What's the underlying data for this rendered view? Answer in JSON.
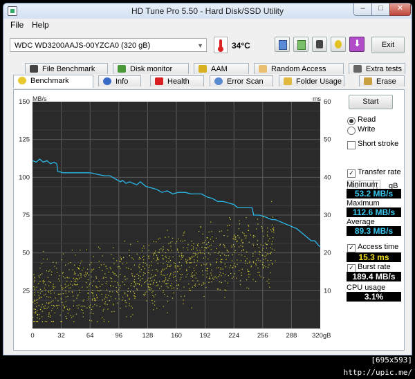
{
  "window": {
    "title": "HD Tune Pro 5.50 - Hard Disk/SSD Utility",
    "controls": {
      "minimize": "–",
      "maximize": "□",
      "close": "✕"
    }
  },
  "menu": {
    "file": "File",
    "help": "Help"
  },
  "toolbar": {
    "drive": "WDC WD3200AAJS-00YZCA0 (320 gB)",
    "temperature": "34°C",
    "exit_label": "Exit",
    "icons": [
      "copy-info-icon",
      "copy-text-icon",
      "camera-icon",
      "options-icon",
      "save-icon"
    ]
  },
  "tabs_top": [
    {
      "label": "File Benchmark",
      "icon": "file-benchmark-icon"
    },
    {
      "label": "Disk monitor",
      "icon": "disk-monitor-icon"
    },
    {
      "label": "AAM",
      "icon": "speaker-icon"
    },
    {
      "label": "Random Access",
      "icon": "random-access-icon"
    },
    {
      "label": "Extra tests",
      "icon": "extra-tests-icon"
    }
  ],
  "tabs_bottom": [
    {
      "label": "Benchmark",
      "icon": "benchmark-icon",
      "active": true
    },
    {
      "label": "Info",
      "icon": "info-icon"
    },
    {
      "label": "Health",
      "icon": "health-icon"
    },
    {
      "label": "Error Scan",
      "icon": "error-scan-icon"
    },
    {
      "label": "Folder Usage",
      "icon": "folder-icon"
    },
    {
      "label": "Erase",
      "icon": "erase-icon"
    }
  ],
  "side": {
    "start_label": "Start",
    "read_label": "Read",
    "write_label": "Write",
    "short_stroke_label": "Short stroke",
    "gb_value": "40",
    "gb_unit": "gB",
    "transfer_rate_label": "Transfer rate",
    "minimum_label": "Minimum",
    "minimum_value": "53.2 MB/s",
    "maximum_label": "Maximum",
    "maximum_value": "112.6 MB/s",
    "average_label": "Average",
    "average_value": "89.3 MB/s",
    "access_time_label": "Access time",
    "access_time_value": "15.3 ms",
    "burst_rate_label": "Burst rate",
    "burst_rate_value": "189.4 MB/s",
    "cpu_usage_label": "CPU usage",
    "cpu_usage_value": "3.1%"
  },
  "colors": {
    "transfer": "#2ab8e8",
    "access": "#d8d230",
    "value_cyan": "#38c8f0",
    "value_yellow": "#f0e020"
  },
  "chart_data": {
    "type": "line",
    "y_left_unit": "MB/s",
    "y_right_unit": "ms",
    "ylim_left": [
      0,
      150
    ],
    "ylim_right": [
      0,
      60
    ],
    "xlim": [
      0,
      320
    ],
    "x_unit": "gB",
    "y_left_ticks": [
      "150",
      "125",
      "100",
      "75",
      "50",
      "25"
    ],
    "y_right_ticks": [
      "60",
      "50",
      "40",
      "30",
      "20",
      "10"
    ],
    "x_ticks": [
      "0",
      "32",
      "64",
      "96",
      "128",
      "160",
      "192",
      "224",
      "256",
      "288",
      "320gB"
    ],
    "transfer_series": {
      "x": [
        0,
        4,
        8,
        12,
        16,
        20,
        24,
        27,
        28,
        34,
        40,
        48,
        56,
        64,
        72,
        80,
        86,
        92,
        98,
        100,
        104,
        108,
        112,
        116,
        120,
        126,
        132,
        138,
        144,
        150,
        156,
        162,
        166,
        170,
        176,
        182,
        188,
        194,
        200,
        206,
        212,
        218,
        224,
        228,
        232,
        236,
        240,
        244,
        246,
        252,
        258,
        262,
        266,
        270,
        274,
        278,
        282,
        286,
        290,
        294,
        298,
        302,
        306,
        310,
        314,
        318,
        320
      ],
      "y": [
        111,
        110,
        112,
        110,
        111,
        109,
        110,
        109,
        104,
        103,
        103,
        103,
        103,
        103,
        102,
        101,
        101,
        99,
        97,
        98,
        96,
        97,
        96,
        95,
        97,
        94,
        93,
        92,
        90,
        91,
        89,
        90,
        90,
        90,
        89,
        89,
        89,
        87,
        86,
        84,
        84,
        83,
        82,
        80,
        80,
        80,
        80,
        80,
        75,
        75,
        74,
        73,
        72,
        72,
        71,
        70,
        69,
        68,
        67,
        66,
        64,
        62,
        60,
        58,
        58,
        55,
        54
      ]
    },
    "access_scatter": {
      "unit": "ms",
      "min_x": 0,
      "max_x": 270,
      "approx_range": [
        2,
        36
      ],
      "average_ms": 15.3
    }
  }
}
